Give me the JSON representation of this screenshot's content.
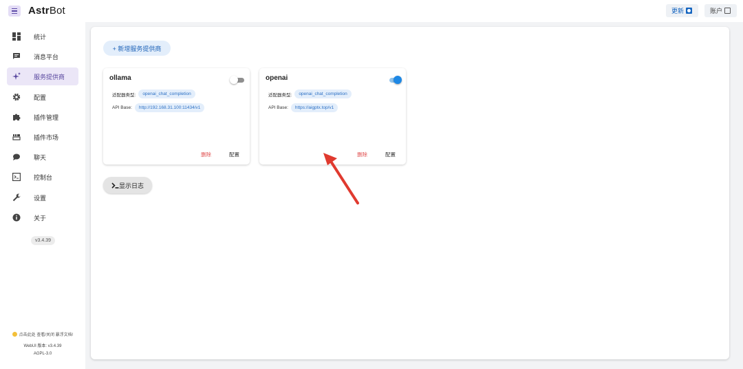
{
  "header": {
    "brand_bold": "Astr",
    "brand_rest": "Bot",
    "update_label": "更新",
    "account_label": "账户"
  },
  "sidebar": {
    "items": [
      {
        "label": "统计",
        "icon": "dashboard-icon"
      },
      {
        "label": "消息平台",
        "icon": "message-icon"
      },
      {
        "label": "服务提供商",
        "icon": "sparkle-icon",
        "active": true
      },
      {
        "label": "配置",
        "icon": "gear-icon"
      },
      {
        "label": "插件管理",
        "icon": "puzzle-icon"
      },
      {
        "label": "插件市场",
        "icon": "store-icon"
      },
      {
        "label": "聊天",
        "icon": "chat-icon"
      },
      {
        "label": "控制台",
        "icon": "console-icon"
      },
      {
        "label": "设置",
        "icon": "wrench-icon"
      },
      {
        "label": "关于",
        "icon": "info-icon"
      }
    ],
    "version": "v3.4.39",
    "tip": "点击此处 查看/关闭 暴浮文档!",
    "webui_version": "WebUI 版本: v3.4.39",
    "license": "AGPL-3.0"
  },
  "main": {
    "add_button": "+ 新增服务提供商",
    "log_button": "显示日志",
    "providers": [
      {
        "name": "ollama",
        "enabled": false,
        "type_label": "适配器类型:",
        "type": "openai_chat_completion",
        "base_label": "API Base:",
        "base": "http://192.168.31.100:11434/v1",
        "delete_label": "删除",
        "config_label": "配置"
      },
      {
        "name": "openai",
        "enabled": true,
        "type_label": "适配器类型:",
        "type": "openai_chat_completion",
        "base_label": "API Base:",
        "base": "https://aigptx.top/v1",
        "delete_label": "删除",
        "config_label": "配置"
      }
    ]
  },
  "colors": {
    "accent": "#5b4aa0",
    "primary": "#1e88e5",
    "danger": "#e05050",
    "arrow": "#e03a2f"
  }
}
